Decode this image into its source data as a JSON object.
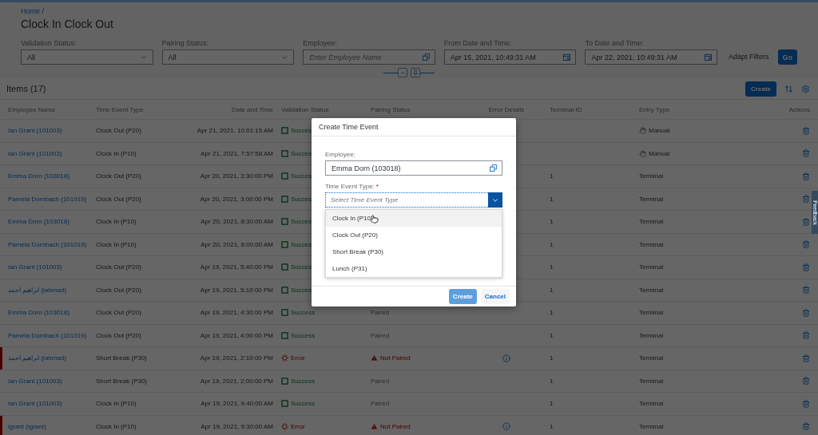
{
  "breadcrumb": "Home /",
  "title": "Clock In Clock Out",
  "filters": [
    {
      "label": "Validation Status:",
      "kind": "select",
      "value": "All"
    },
    {
      "label": "Pairing Status:",
      "kind": "select",
      "value": "All"
    },
    {
      "label": "Employee:",
      "kind": "valuehelp",
      "placeholder": "Enter Employee Name"
    },
    {
      "label": "From Date and Time:",
      "kind": "date",
      "value": "Apr 15, 2021, 10:49:31 AM"
    },
    {
      "label": "To Date and Time:",
      "kind": "date",
      "value": "Apr 22, 2021, 10:49:31 AM"
    }
  ],
  "adapt_filters": "Adapt Filters",
  "go_button": "Go",
  "table": {
    "title": "Items (17)",
    "create_button": "Create",
    "columns": [
      "Employee Name",
      "Time Event Type",
      "Date and Time",
      "Validation Status",
      "Pairing Status",
      "Error Details",
      "Terminal ID",
      "Entry Type",
      "Actions"
    ],
    "rows": [
      {
        "employee": "Ian Grant (101003)",
        "type": "Clock Out (P20)",
        "date": "Apr 21, 2021, 10:01:15 AM",
        "validation": {
          "kind": "success",
          "label": "Succes"
        },
        "error_details": false,
        "entry": {
          "kind": "manual",
          "label": "Manual"
        }
      },
      {
        "employee": "Ian Grant (101003)",
        "type": "Clock In (P10)",
        "date": "Apr 21, 2021, 7:57:58 AM",
        "validation": {
          "kind": "success",
          "label": "Succes"
        },
        "error_details": false,
        "entry": {
          "kind": "manual",
          "label": "Manual"
        }
      },
      {
        "employee": "Emma Dorn (103018)",
        "type": "Clock Out (P20)",
        "date": "Apr 20, 2021, 3:30:00 PM",
        "validation": {
          "kind": "success",
          "label": "Succes"
        },
        "error_details": false,
        "terminal": "1",
        "entry": {
          "kind": "terminal",
          "label": "Terminal"
        }
      },
      {
        "employee": "Pamela Dornbach (101019)",
        "type": "Clock Out (P20)",
        "date": "Apr 20, 2021, 3:00:00 PM",
        "validation": {
          "kind": "success",
          "label": "Succes"
        },
        "error_details": false,
        "terminal": "1",
        "entry": {
          "kind": "terminal",
          "label": "Terminal"
        }
      },
      {
        "employee": "Emma Dorn (103018)",
        "type": "Clock In (P10)",
        "date": "Apr 20, 2021, 8:30:00 AM",
        "validation": {
          "kind": "success",
          "label": "Succes"
        },
        "error_details": false,
        "terminal": "1",
        "entry": {
          "kind": "terminal",
          "label": "Terminal"
        }
      },
      {
        "employee": "Pamela Dornbach (101019)",
        "type": "Clock In (P10)",
        "date": "Apr 20, 2021, 8:00:00 AM",
        "validation": {
          "kind": "success",
          "label": "Succes"
        },
        "error_details": false,
        "terminal": "1",
        "entry": {
          "kind": "terminal",
          "label": "Terminal"
        }
      },
      {
        "employee": "Ian Grant (101003)",
        "type": "Clock Out (P20)",
        "date": "Apr 19, 2021, 5:40:00 PM",
        "validation": {
          "kind": "success",
          "label": "Succes"
        },
        "error_details": false,
        "terminal": "1",
        "entry": {
          "kind": "terminal",
          "label": "Terminal"
        }
      },
      {
        "employee": "ابراهيم احمد (iahmad)",
        "type": "Clock Out (P20)",
        "date": "Apr 19, 2021, 5:10:00 PM",
        "validation": {
          "kind": "success",
          "label": "Succes"
        },
        "error_details": false,
        "terminal": "1",
        "entry": {
          "kind": "terminal",
          "label": "Terminal"
        }
      },
      {
        "employee": "Emma Dorn (103018)",
        "type": "Clock Out (P20)",
        "date": "Apr 19, 2021, 4:30:00 PM",
        "validation": {
          "kind": "success",
          "label": "Success"
        },
        "pairing": {
          "kind": "paired",
          "label": "Paired"
        },
        "error_details": false,
        "terminal": "1",
        "entry": {
          "kind": "terminal",
          "label": "Terminal"
        }
      },
      {
        "employee": "Pamela Dornbach (101019)",
        "type": "Clock Out (P20)",
        "date": "Apr 19, 2021, 4:00:00 PM",
        "validation": {
          "kind": "success",
          "label": "Success"
        },
        "pairing": {
          "kind": "paired",
          "label": "Paired"
        },
        "error_details": false,
        "terminal": "1",
        "entry": {
          "kind": "terminal",
          "label": "Terminal"
        }
      },
      {
        "employee": "ابراهيم احمد (iahmad)",
        "type": "Short Break (P30)",
        "date": "Apr 19, 2021, 2:10:00 PM",
        "validation": {
          "kind": "error",
          "label": "Error"
        },
        "pairing": {
          "kind": "not_paired",
          "label": "Not Paired"
        },
        "error_details": true,
        "terminal": "1",
        "entry": {
          "kind": "terminal",
          "label": "Terminal"
        }
      },
      {
        "employee": "Ian Grant (101003)",
        "type": "Short Break (P30)",
        "date": "Apr 19, 2021, 2:00:00 PM",
        "validation": {
          "kind": "success",
          "label": "Success"
        },
        "pairing": {
          "kind": "paired",
          "label": "Paired"
        },
        "error_details": false,
        "terminal": "1",
        "entry": {
          "kind": "terminal",
          "label": "Terminal"
        }
      },
      {
        "employee": "Ian Grant (101003)",
        "type": "Clock In (P10)",
        "date": "Apr 19, 2021, 9:40:00 AM",
        "validation": {
          "kind": "success",
          "label": "Success"
        },
        "pairing": {
          "kind": "paired",
          "label": "Paired"
        },
        "error_details": false,
        "terminal": "1",
        "entry": {
          "kind": "terminal",
          "label": "Terminal"
        }
      },
      {
        "employee": "igrant (igrant)",
        "type": "Clock In (P10)",
        "date": "Apr 19, 2021, 9:30:00 AM",
        "validation": {
          "kind": "error",
          "label": "Error"
        },
        "pairing": {
          "kind": "not_paired",
          "label": "Not Paired"
        },
        "error_details": true,
        "terminal": "1",
        "entry": {
          "kind": "terminal",
          "label": "Terminal"
        }
      }
    ]
  },
  "feedback_tab": "Feedback",
  "dialog": {
    "title": "Create Time Event",
    "employee_label": "Employee:",
    "employee_value": "Emma Dorn (103018)",
    "type_label": "Time Event Type:",
    "required_mark": "*",
    "type_placeholder": "Select Time Event Type",
    "options": [
      {
        "label": "Clock In (P10)",
        "hovered": true
      },
      {
        "label": "Clock Out (P20)",
        "hovered": false
      },
      {
        "label": "Short Break (P30)",
        "hovered": false
      },
      {
        "label": "Lunch (P31)",
        "hovered": false
      }
    ],
    "buttons": [
      {
        "label": "Create",
        "kind": "primary"
      },
      {
        "label": "Cancel",
        "kind": "plain"
      }
    ]
  }
}
